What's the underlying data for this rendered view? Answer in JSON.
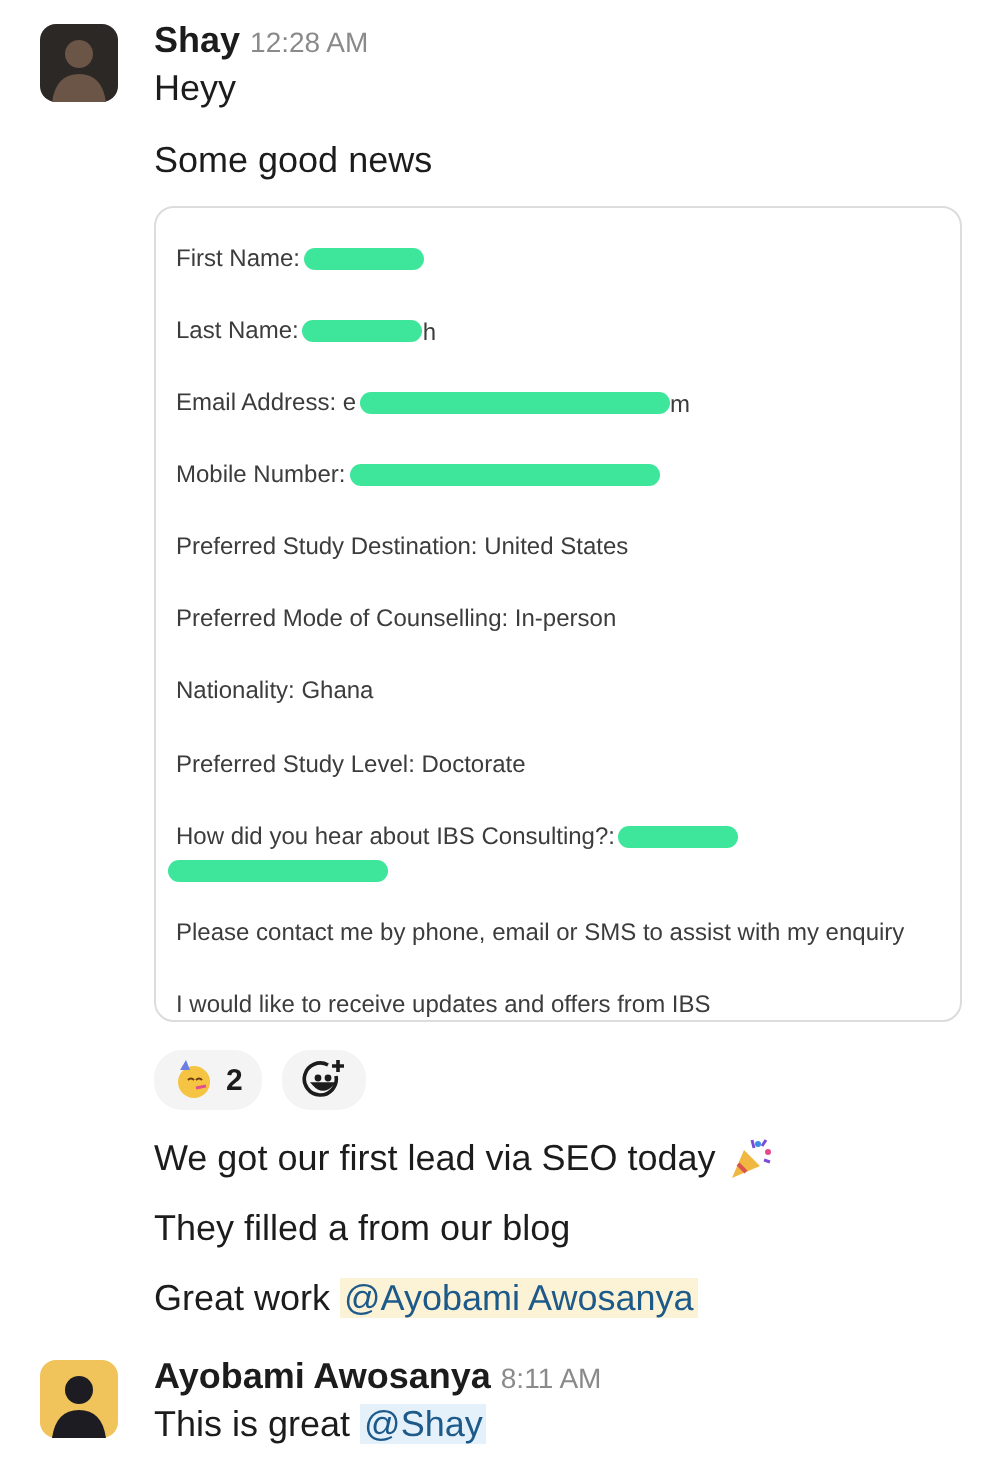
{
  "messages": [
    {
      "author": "Shay",
      "time": "12:28 AM",
      "blocks": [
        {
          "kind": "text",
          "text": "Heyy"
        },
        {
          "kind": "text",
          "text": "Some good news"
        },
        {
          "kind": "form",
          "fields": [
            {
              "label": "First Name:",
              "redacted": true
            },
            {
              "label": "Last Name:",
              "redacted": true,
              "after": "h"
            },
            {
              "label": "Email Address: e",
              "redacted": true,
              "after": "m"
            },
            {
              "label": "Mobile Number:",
              "redacted": true
            },
            {
              "label": "Preferred Study Destination: United States",
              "redacted": false
            },
            {
              "label": "Preferred Mode of Counselling: In-person",
              "redacted": false
            },
            {
              "label": "Nationality: Ghana",
              "redacted": false
            },
            {
              "label": "Preferred Study Level: Doctorate",
              "redacted": false
            },
            {
              "label": "How did you hear about IBS Consulting?:",
              "redacted": true,
              "wraps": true
            },
            {
              "label": "Please contact me by phone, email or SMS to assist with my enquiry",
              "redacted": false
            },
            {
              "label": "I would like to receive updates and offers from IBS",
              "redacted": false
            }
          ]
        },
        {
          "kind": "reactions",
          "reactions": [
            {
              "count": "2"
            }
          ]
        },
        {
          "kind": "text",
          "text": "We got our first lead via SEO today",
          "party_emoji": true
        },
        {
          "kind": "text",
          "text": "They filled a from our blog"
        },
        {
          "kind": "text",
          "text": "Great work ",
          "mention": "@Ayobami Awosanya",
          "mention_self": true
        }
      ]
    },
    {
      "author": "Ayobami Awosanya",
      "time": "8:11 AM",
      "blocks": [
        {
          "kind": "text",
          "text": "This is great ",
          "mention": "@Shay",
          "mention_self": false
        }
      ]
    }
  ]
}
